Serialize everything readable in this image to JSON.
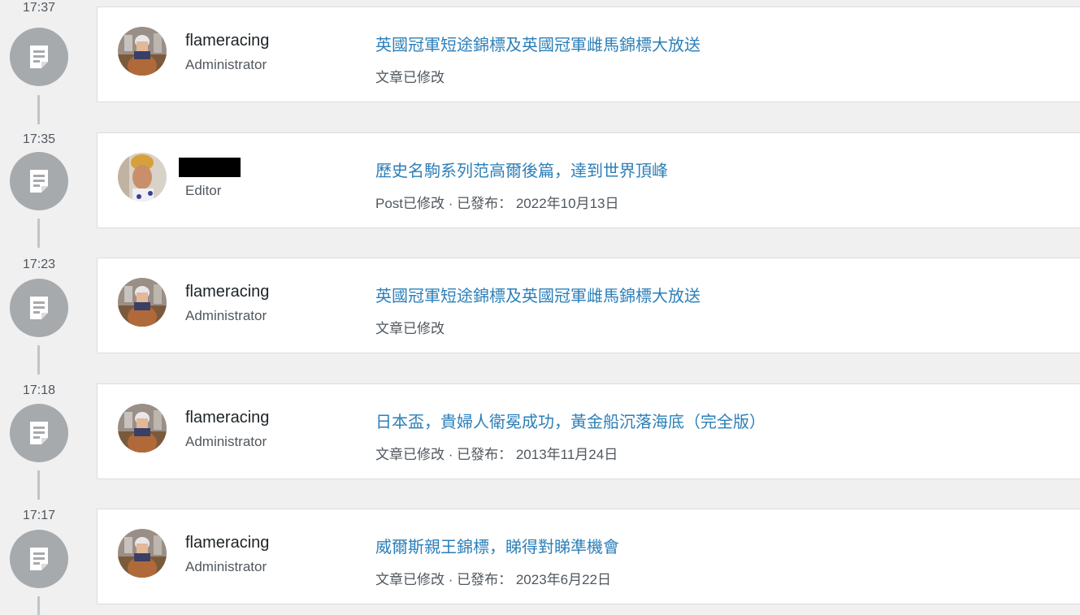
{
  "entries": [
    {
      "time": "17:37",
      "user": {
        "name": "flameracing",
        "role": "Administrator",
        "redacted": false
      },
      "title": "英國冠軍短途錦標及英國冠軍雌馬錦標大放送",
      "meta": "文章已修改"
    },
    {
      "time": "17:35",
      "user": {
        "name": "",
        "role": "Editor",
        "redacted": true
      },
      "title": "歷史名駒系列范高爾後篇，達到世界頂峰",
      "meta": "Post已修改 · 已發布： 2022年10月13日"
    },
    {
      "time": "17:23",
      "user": {
        "name": "flameracing",
        "role": "Administrator",
        "redacted": false
      },
      "title": "英國冠軍短途錦標及英國冠軍雌馬錦標大放送",
      "meta": "文章已修改"
    },
    {
      "time": "17:18",
      "user": {
        "name": "flameracing",
        "role": "Administrator",
        "redacted": false
      },
      "title": "日本盃，貴婦人衛冕成功，黃金船沉落海底（完全版）",
      "meta": "文章已修改 · 已發布： 2013年11月24日"
    },
    {
      "time": "17:17",
      "user": {
        "name": "flameracing",
        "role": "Administrator",
        "redacted": false
      },
      "title": "威爾斯親王錦標，睇得對睇準機會",
      "meta": "文章已修改 · 已發布： 2023年6月22日"
    }
  ],
  "icons": {
    "entry": "document-icon"
  },
  "colors": {
    "link": "#2c7fb8",
    "icon_circle": "#a7aaad",
    "background": "#f0f0f1"
  }
}
